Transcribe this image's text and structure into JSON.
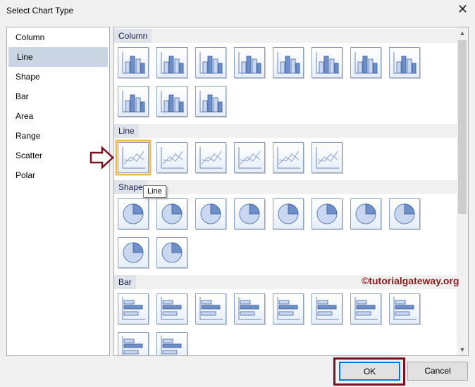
{
  "dialog": {
    "title": "Select Chart Type",
    "close": "✕"
  },
  "categories": [
    "Column",
    "Line",
    "Shape",
    "Bar",
    "Area",
    "Range",
    "Scatter",
    "Polar"
  ],
  "selected_category": "Line",
  "sections": [
    {
      "label": "Column",
      "kind": "column",
      "count": 11
    },
    {
      "label": "Line",
      "kind": "line",
      "count": 6,
      "selected_index": 0
    },
    {
      "label": "Shape",
      "kind": "shape",
      "count": 10
    },
    {
      "label": "Bar",
      "kind": "bar",
      "count": 10
    }
  ],
  "tooltip": "Line",
  "watermark": "©tutorialgateway.org",
  "buttons": {
    "ok": "OK",
    "cancel": "Cancel"
  },
  "colors": {
    "accent": "#0078d7",
    "annotation": "#7b1020",
    "selected_item": "#c9d5e3"
  }
}
